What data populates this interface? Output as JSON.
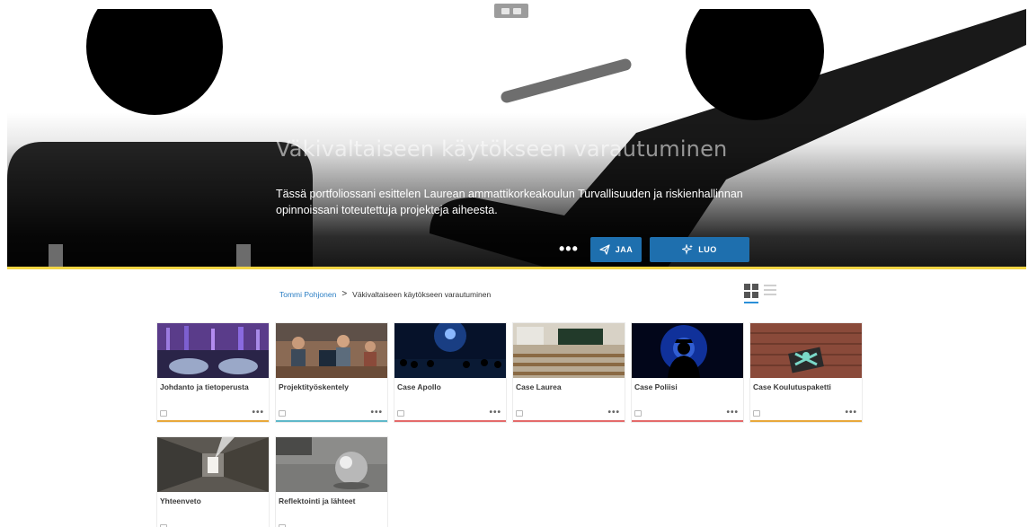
{
  "hero": {
    "title": "Väkivaltaiseen käytökseen varautuminen",
    "description": "Tässä portfoliossani esittelen Laurean ammattikorkeakoulun Turvallisuuden ja riskienhallinnan opinnoissani toteutettuja projekteja aiheesta.",
    "more_label": "•••",
    "share_label": "JAA",
    "create_label": "LUO"
  },
  "breadcrumb": {
    "owner": "Tommi Pohjonen",
    "separator": ">",
    "current": "Väkivaltaiseen käytökseen varautuminen"
  },
  "view": {
    "selected": "grid",
    "options": [
      "grid",
      "list"
    ]
  },
  "cards": [
    {
      "title": "Johdanto ja tietoperusta",
      "accent": "#e8a83a",
      "icon": "page-icon",
      "more": "•••"
    },
    {
      "title": "Projektityöskentely",
      "accent": "#5fb8c9",
      "icon": "page-icon",
      "more": "•••"
    },
    {
      "title": "Case Apollo",
      "accent": "#e46b6b",
      "icon": "page-icon",
      "more": "•••"
    },
    {
      "title": "Case Laurea",
      "accent": "#e46b6b",
      "icon": "page-icon",
      "more": "•••"
    },
    {
      "title": "Case Poliisi",
      "accent": "#e46b6b",
      "icon": "page-icon",
      "more": "•••"
    },
    {
      "title": "Case Koulutuspaketti",
      "accent": "#e8a83a",
      "icon": "page-icon",
      "more": "•••"
    },
    {
      "title": "Yhteenveto",
      "accent": "#e0e0e0",
      "icon": "page-icon",
      "more": ""
    },
    {
      "title": "Reflektointi ja lähteet",
      "accent": "#e0e0e0",
      "icon": "page-icon",
      "more": ""
    }
  ],
  "colors": {
    "accent_blue": "#1e6fae",
    "link_blue": "#2a7ec4",
    "yellow_strip": "#f2d544"
  }
}
